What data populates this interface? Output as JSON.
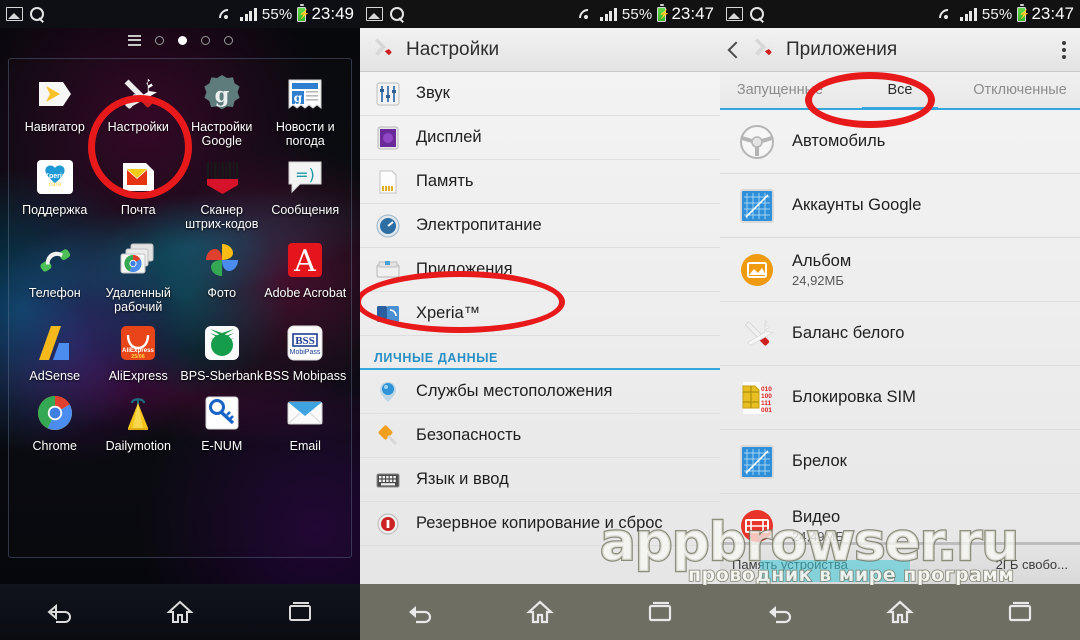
{
  "statusbars": {
    "left": {
      "battery": "55%",
      "time": "23:49",
      "icons": [
        "image-icon",
        "search-icon",
        "wifi-icon",
        "signal-icon",
        "battery-icon"
      ]
    },
    "middle": {
      "battery": "55%",
      "time": "23:47",
      "icons": [
        "image-icon",
        "search-icon",
        "wifi-icon",
        "signal-icon",
        "battery-icon"
      ]
    },
    "right": {
      "battery": "55%",
      "time": "23:47",
      "icons": [
        "image-icon",
        "search-icon",
        "wifi-icon",
        "signal-icon",
        "battery-icon"
      ]
    }
  },
  "home": {
    "page_dots": {
      "count": 4,
      "active_index": 1,
      "menu_icon": "grid-menu-icon"
    },
    "apps": [
      {
        "label": "Навигатор",
        "icon": "navigator-icon"
      },
      {
        "label": "Настройки",
        "icon": "settings-tools-icon",
        "highlighted": true
      },
      {
        "label": "Настройки Google",
        "icon": "google-settings-icon"
      },
      {
        "label": "Новости и погода",
        "icon": "news-weather-icon"
      },
      {
        "label": "Поддержка",
        "icon": "xperia-care-icon"
      },
      {
        "label": "Почта",
        "icon": "mail-icon"
      },
      {
        "label": "Сканер штрих-кодов",
        "icon": "barcode-scanner-icon"
      },
      {
        "label": "Сообщения",
        "icon": "messaging-icon"
      },
      {
        "label": "Телефон",
        "icon": "phone-icon"
      },
      {
        "label": "Удаленный рабочий",
        "icon": "chrome-remote-desktop-icon"
      },
      {
        "label": "Фото",
        "icon": "google-photos-icon"
      },
      {
        "label": "Adobe Acrobat",
        "icon": "adobe-acrobat-icon"
      },
      {
        "label": "AdSense",
        "icon": "adsense-icon"
      },
      {
        "label": "AliExpress",
        "icon": "aliexpress-icon"
      },
      {
        "label": "BPS-Sberbank",
        "icon": "sberbank-icon"
      },
      {
        "label": "BSS Mobipass",
        "icon": "bss-mobipass-icon"
      },
      {
        "label": "Chrome",
        "icon": "chrome-icon"
      },
      {
        "label": "Dailymotion",
        "icon": "dailymotion-icon"
      },
      {
        "label": "E-NUM",
        "icon": "enum-key-icon"
      },
      {
        "label": "Email",
        "icon": "email-envelope-icon"
      }
    ]
  },
  "settings": {
    "header": {
      "title": "Настройки",
      "icon": "settings-tools-icon"
    },
    "rows": [
      {
        "label": "Звук",
        "icon": "sound-sliders-icon"
      },
      {
        "label": "Дисплей",
        "icon": "display-icon"
      },
      {
        "label": "Память",
        "icon": "storage-card-icon"
      },
      {
        "label": "Электропитание",
        "icon": "power-gauge-icon"
      },
      {
        "label": "Приложения",
        "icon": "apps-box-icon",
        "highlighted": true
      },
      {
        "label": "Xperia™",
        "icon": "xperia-icon"
      }
    ],
    "section_label": "ЛИЧНЫЕ ДАННЫЕ",
    "rows2": [
      {
        "label": "Службы местоположения",
        "icon": "location-pin-icon"
      },
      {
        "label": "Безопасность",
        "icon": "security-key-icon"
      },
      {
        "label": "Язык и ввод",
        "icon": "keyboard-icon"
      },
      {
        "label": "Резервное копирование и сброс",
        "icon": "backup-reset-icon"
      }
    ]
  },
  "apps_screen": {
    "header": {
      "title": "Приложения",
      "back_icon": "back-chevron-icon",
      "app_icon": "settings-tools-icon",
      "overflow_icon": "overflow-menu-icon"
    },
    "tabs": [
      {
        "label": "Запущенные",
        "active": false
      },
      {
        "label": "Все",
        "active": true,
        "highlighted": true
      },
      {
        "label": "Отключенные",
        "active": false
      }
    ],
    "items": [
      {
        "name": "Автомобиль",
        "size": "",
        "icon": "steering-wheel-icon"
      },
      {
        "name": "Аккаунты Google",
        "size": "",
        "icon": "blueprint-icon"
      },
      {
        "name": "Альбом",
        "size": "24,92МБ",
        "icon": "album-photo-icon"
      },
      {
        "name": "Баланс белого",
        "size": "",
        "icon": "white-balance-tools-icon"
      },
      {
        "name": "Блокировка SIM",
        "size": "",
        "icon": "sim-card-icon"
      },
      {
        "name": "Брелок",
        "size": "",
        "icon": "blueprint-icon"
      },
      {
        "name": "Видео",
        "size": "24,49МБ",
        "icon": "video-film-icon"
      }
    ],
    "storage": {
      "left_label": "Память устройства",
      "right_label": "2ГБ свобо..."
    }
  },
  "navbar": {
    "buttons": [
      "back-icon",
      "home-icon",
      "recents-icon"
    ]
  },
  "watermark": {
    "main": "appbrowser.ru",
    "sub": "проводник в мире программ"
  },
  "colors": {
    "accent": "#33a7dd",
    "annotation": "#e8191b",
    "section_text": "#2a8fc4"
  }
}
